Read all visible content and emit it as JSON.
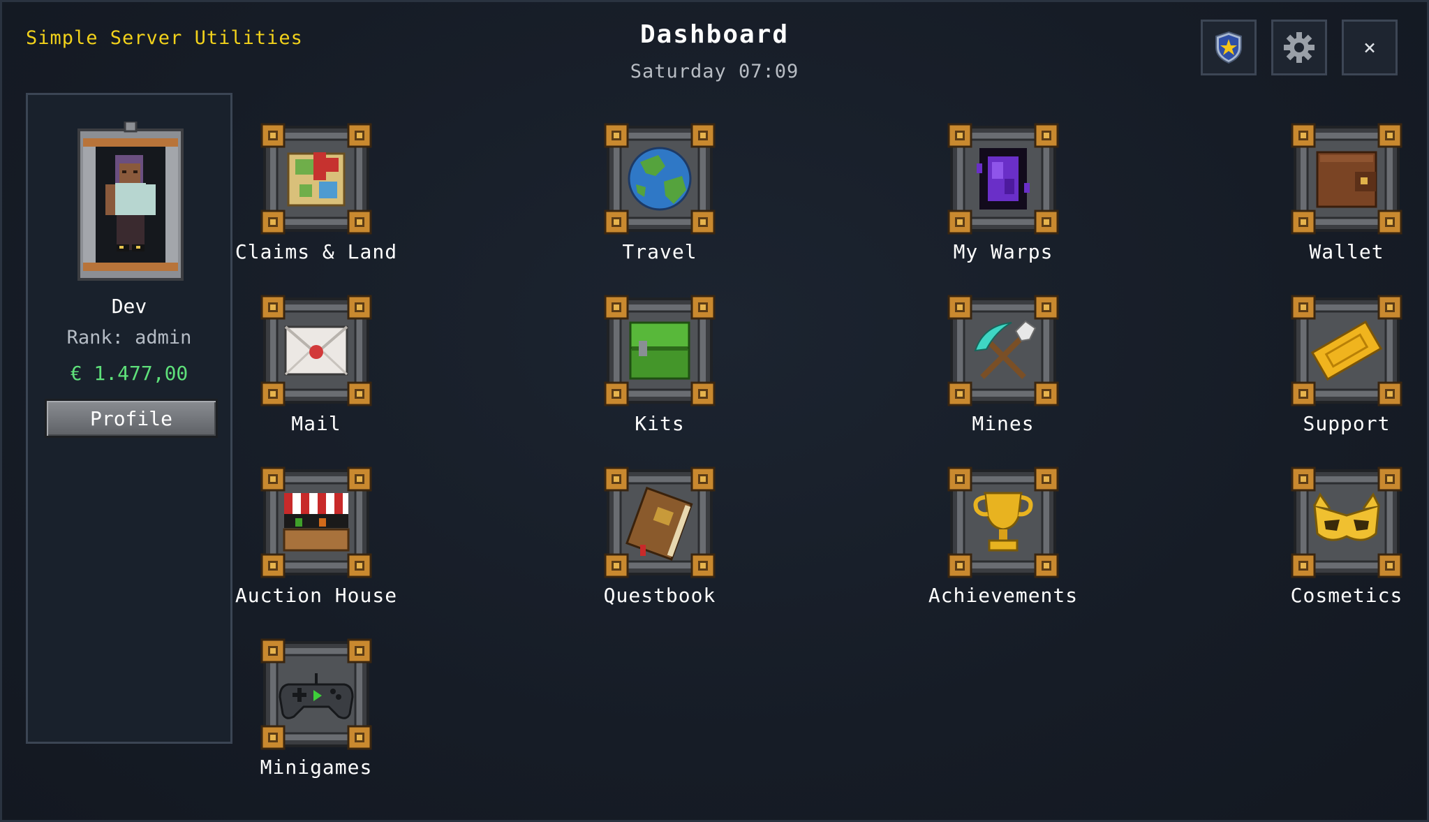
{
  "app": {
    "title": "Simple Server Utilities"
  },
  "header": {
    "title": "Dashboard",
    "datetime": "Saturday 07:09"
  },
  "toolbar": {
    "buttons": [
      {
        "name": "rank-badge",
        "icon": "shield-star-icon"
      },
      {
        "name": "settings",
        "icon": "gear-icon"
      },
      {
        "name": "close",
        "icon": "close-icon",
        "glyph": "×"
      }
    ]
  },
  "player": {
    "name": "Dev",
    "rank": "Rank: admin",
    "balance": "€ 1.477,00",
    "profile_label": "Profile"
  },
  "tiles": [
    {
      "label": "Claims & Land",
      "icon": "map-icon"
    },
    {
      "label": "Travel",
      "icon": "globe-icon"
    },
    {
      "label": "My Warps",
      "icon": "portal-icon"
    },
    {
      "label": "Wallet",
      "icon": "wallet-icon"
    },
    {
      "label": "Mail",
      "icon": "envelope-icon"
    },
    {
      "label": "Kits",
      "icon": "chest-icon"
    },
    {
      "label": "Mines",
      "icon": "pickaxe-shovel-icon"
    },
    {
      "label": "Support",
      "icon": "ticket-icon"
    },
    {
      "label": "Auction House",
      "icon": "market-stall-icon"
    },
    {
      "label": "Questbook",
      "icon": "book-icon"
    },
    {
      "label": "Achievements",
      "icon": "trophy-icon"
    },
    {
      "label": "Cosmetics",
      "icon": "mask-icon"
    },
    {
      "label": "Minigames",
      "icon": "gamepad-icon"
    }
  ],
  "colors": {
    "app_title": "#f2d21b",
    "balance": "#5ee07a",
    "frame_gold": "#c9892f",
    "frame_stone": "#5a5d62"
  }
}
